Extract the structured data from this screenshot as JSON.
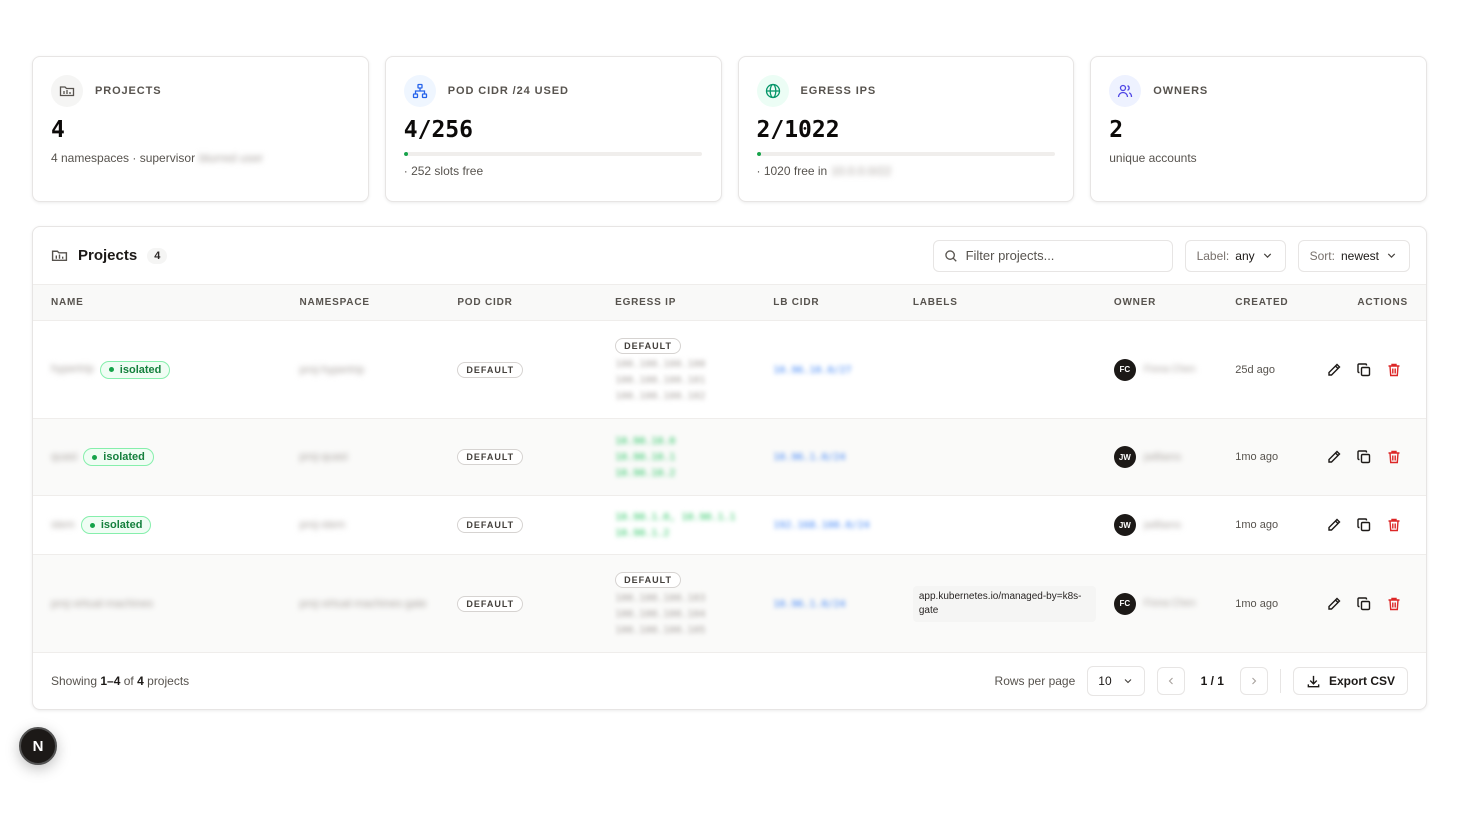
{
  "stats": [
    {
      "label": "PROJECTS",
      "value": "4",
      "sub_prefix": "4 namespaces · supervisor",
      "sub_blurred": "blurred user",
      "icon": "folder-icon",
      "icon_bg": "#f5f5f4",
      "icon_color": "#57534e"
    },
    {
      "label": "POD CIDR /24 USED",
      "value": "4/256",
      "sub_prefix": "· 252 slots free",
      "progress": 0.0156,
      "icon": "network-icon",
      "icon_bg": "#eff6ff",
      "icon_color": "#2563eb"
    },
    {
      "label": "EGRESS IPS",
      "value": "2/1022",
      "sub_prefix": "· 1020 free in",
      "sub_blurred": "10.0.0.0/22",
      "progress": 0.002,
      "icon": "globe-icon",
      "icon_bg": "#ecfdf5",
      "icon_color": "#059669"
    },
    {
      "label": "OWNERS",
      "value": "2",
      "sub_prefix": "unique accounts",
      "icon": "users-icon",
      "icon_bg": "#eef2ff",
      "icon_color": "#4f46e5"
    }
  ],
  "toolbar": {
    "title": "Projects",
    "count": "4",
    "search_placeholder": "Filter projects...",
    "label_key": "Label:",
    "label_value": "any",
    "sort_key": "Sort:",
    "sort_value": "newest"
  },
  "columns": [
    "NAME",
    "NAMESPACE",
    "POD CIDR",
    "EGRESS IP",
    "LB CIDR",
    "LABELS",
    "OWNER",
    "CREATED",
    "ACTIONS"
  ],
  "rows": [
    {
      "name": "hypertrip",
      "status": "isolated",
      "namespace": "proj-hypertrip",
      "pod_cidr": "DEFAULT",
      "egress_default": "DEFAULT",
      "egress_ips": [
        "100.100.100.100",
        "100.100.100.101",
        "100.100.100.102"
      ],
      "egress_green": [],
      "lb_cidr": "10.96.10.0/27",
      "label": "",
      "owner_initials": "FC",
      "owner_name": "Fiona Chen",
      "created": "25d ago"
    },
    {
      "name": "quasi",
      "status": "isolated",
      "namespace": "proj-quasi",
      "pod_cidr": "DEFAULT",
      "egress_default": "",
      "egress_ips": [],
      "egress_green": [
        "10.90.10.0",
        "10.90.10.1",
        "10.90.10.2"
      ],
      "lb_cidr": "10.96.1.0/24",
      "label": "",
      "owner_initials": "JW",
      "owner_name": "jwilliams",
      "created": "1mo ago"
    },
    {
      "name": "stem",
      "status": "isolated",
      "namespace": "proj-stem",
      "pod_cidr": "DEFAULT",
      "egress_default": "",
      "egress_ips": [],
      "egress_green": [
        "10.90.1.0, 10.90.1.1",
        "10.90.1.2"
      ],
      "lb_cidr": "192.168.100.0/24",
      "label": "",
      "owner_initials": "JW",
      "owner_name": "jwilliams",
      "created": "1mo ago"
    },
    {
      "name": "proj-virtual-machines",
      "status": "",
      "namespace": "proj-virtual-machines-gate",
      "pod_cidr": "DEFAULT",
      "egress_default": "DEFAULT",
      "egress_ips": [
        "100.100.100.103",
        "100.100.100.104",
        "100.100.100.105"
      ],
      "egress_green": [],
      "lb_cidr": "10.96.1.0/24",
      "label": "app.kubernetes.io/managed-by=k8s-gate",
      "owner_initials": "FC",
      "owner_name": "Fiona Chen",
      "created": "1mo ago"
    }
  ],
  "footer": {
    "showing_prefix": "Showing",
    "showing_range": "1–4",
    "showing_of": "of",
    "showing_total": "4",
    "showing_suffix": "projects",
    "rows_per_page_label": "Rows per page",
    "rows_per_page_value": "10",
    "page_indicator": "1 / 1",
    "export_label": "Export CSV"
  },
  "badge": {
    "letter": "N"
  },
  "colors": {
    "accent_green": "#16a34a",
    "danger": "#dc2626",
    "link_blue": "#3b82f6"
  }
}
